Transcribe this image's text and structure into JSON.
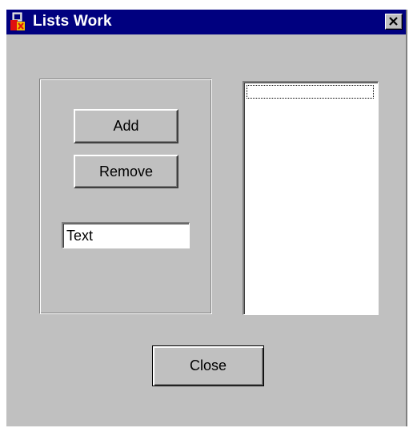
{
  "window": {
    "title": "Lists Work",
    "close_icon": "close-x-icon",
    "app_icon": "app-logo-icon"
  },
  "controls": {
    "add_label": "Add",
    "remove_label": "Remove",
    "text_field_value": "Text",
    "close_label": "Close"
  },
  "list": {
    "items": []
  },
  "colors": {
    "titlebar": "#00007f",
    "face": "#c0c0c0",
    "shadow": "#808080",
    "highlight": "#ffffff"
  }
}
